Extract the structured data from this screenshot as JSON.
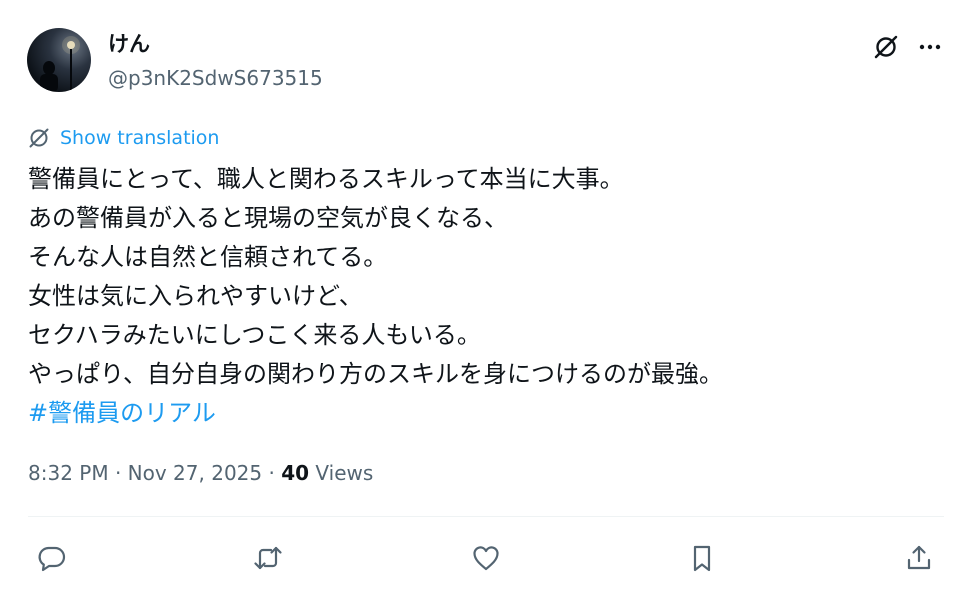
{
  "author": {
    "display_name": "けん",
    "handle": "@p3nK2SdwS673515",
    "avatar_icon": "avatar-image"
  },
  "header_actions": {
    "grok_icon": "grok-icon",
    "more_icon": "more-icon"
  },
  "translation": {
    "label": "Show translation",
    "icon": "translate-icon"
  },
  "tweet": {
    "lines": [
      "警備員にとって、職人と関わるスキルって本当に大事。",
      "あの警備員が入ると現場の空気が良くなる、",
      "そんな人は自然と信頼されてる。",
      "女性は気に入られやすいけど、",
      "セクハラみたいにしつこく来る人もいる。",
      "やっぱり、自分自身の関わり方のスキルを身につけるのが最強。"
    ],
    "hashtag": "#警備員のリアル"
  },
  "meta": {
    "timestamp": "8:32 PM · Nov 27, 2025 · ",
    "views_count": "40",
    "views_label": " Views"
  },
  "actions": [
    "reply-icon",
    "retweet-icon",
    "like-icon",
    "bookmark-icon",
    "share-icon"
  ],
  "colors": {
    "accent": "#1d9bf0",
    "secondary_text": "#536471",
    "primary_text": "#0f1419",
    "divider": "#eff3f4"
  }
}
